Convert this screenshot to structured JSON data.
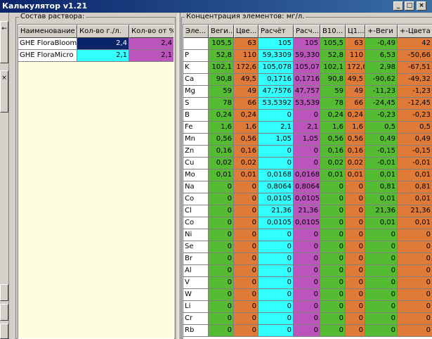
{
  "window": {
    "title": "Калькулятор v1.21",
    "buttons": [
      "_",
      "□",
      "×"
    ]
  },
  "left_strip": {
    "buttons": [
      "←",
      "×",
      "",
      ""
    ]
  },
  "solution": {
    "title": "Состав раствора:",
    "columns": [
      "Наименование",
      "Кол-во г./л.",
      "Кол-во от %"
    ],
    "rows": [
      {
        "name": "GHE FloraBloom",
        "grams": "2,4",
        "percent": "2,4"
      },
      {
        "name": "GHE FloraMicro",
        "grams": "2,1",
        "percent": "2,1"
      }
    ]
  },
  "concentration": {
    "title": "Концентрация элементов: мг/л.",
    "columns": [
      "Эле...",
      "Веги...",
      "Цве...",
      "Расчёт",
      "Расч...",
      "В10...",
      "Ц1...",
      "+-Веги",
      "+-Цвета"
    ],
    "rows": [
      [
        "N",
        "105,5",
        "63",
        "105",
        "105",
        "105,5",
        "63",
        "-0,49",
        "42"
      ],
      [
        "P",
        "52,8",
        "110",
        "59,3309",
        "59,3309",
        "52,8",
        "110",
        "6,53",
        "-50,66"
      ],
      [
        "K",
        "102,1",
        "172,6",
        "105,078",
        "105,078",
        "102,1",
        "172,6",
        "2,98",
        "-67,51"
      ],
      [
        "Ca",
        "90,8",
        "49,5",
        "0,1716",
        "0,1716",
        "90,8",
        "49,5",
        "-90,62",
        "-49,32"
      ],
      [
        "Mg",
        "59",
        "49",
        "47,7576",
        "47,7576",
        "59",
        "49",
        "-11,23",
        "-1,23"
      ],
      [
        "S",
        "78",
        "66",
        "53,5392",
        "53,5392",
        "78",
        "66",
        "-24,45",
        "-12,45"
      ],
      [
        "B",
        "0,24",
        "0,24",
        "0",
        "0",
        "0,24",
        "0,24",
        "-0,23",
        "-0,23"
      ],
      [
        "Fe",
        "1,6",
        "1,6",
        "2,1",
        "2,1",
        "1,6",
        "1,6",
        "0,5",
        "0,5"
      ],
      [
        "Mn",
        "0,56",
        "0,56",
        "1,05",
        "1,05",
        "0,56",
        "0,56",
        "0,49",
        "0,49"
      ],
      [
        "Zn",
        "0,16",
        "0,16",
        "0",
        "0",
        "0,16",
        "0,16",
        "-0,15",
        "-0,15"
      ],
      [
        "Cu",
        "0,02",
        "0,02",
        "0",
        "0",
        "0,02",
        "0,02",
        "-0,01",
        "-0,01"
      ],
      [
        "Mo",
        "0,01",
        "0,01",
        "0,0168",
        "0,0168",
        "0,01",
        "0,01",
        "0,01",
        "0,01"
      ],
      [
        "Na",
        "0",
        "0",
        "0,8064",
        "0,8064",
        "0",
        "0",
        "0,81",
        "0,81"
      ],
      [
        "Co",
        "0",
        "0",
        "0,0105",
        "0,0105",
        "0",
        "0",
        "0,01",
        "0,01"
      ],
      [
        "Cl",
        "0",
        "0",
        "21,36",
        "21,36",
        "0",
        "0",
        "21,36",
        "21,36"
      ],
      [
        "Co",
        "0",
        "0",
        "0,0105",
        "0,0105",
        "0",
        "0",
        "0,01",
        "0,01"
      ],
      [
        "Ni",
        "0",
        "0",
        "0",
        "0",
        "0",
        "0",
        "0",
        "0"
      ],
      [
        "Se",
        "0",
        "0",
        "0",
        "0",
        "0",
        "0",
        "0",
        "0"
      ],
      [
        "Br",
        "0",
        "0",
        "0",
        "0",
        "0",
        "0",
        "0",
        "0"
      ],
      [
        "Al",
        "0",
        "0",
        "0",
        "0",
        "0",
        "0",
        "0",
        "0"
      ],
      [
        "V",
        "0",
        "0",
        "0",
        "0",
        "0",
        "0",
        "0",
        "0"
      ],
      [
        "W",
        "0",
        "0",
        "0",
        "0",
        "0",
        "0",
        "0",
        "0"
      ],
      [
        "Li",
        "0",
        "0",
        "0",
        "0",
        "0",
        "0",
        "0",
        "0"
      ],
      [
        "Cr",
        "0",
        "0",
        "0",
        "0",
        "0",
        "0",
        "0",
        "0"
      ],
      [
        "Rb",
        "0",
        "0",
        "0",
        "0",
        "0",
        "0",
        "0",
        "0"
      ]
    ]
  },
  "colors": {
    "green": "#55bb33",
    "orange": "#e07a38",
    "cyan": "#33ffff",
    "magenta": "#bb55bb",
    "cream": "#fffde0",
    "titlebar": "#0a246a",
    "selected": "#0a246a"
  }
}
